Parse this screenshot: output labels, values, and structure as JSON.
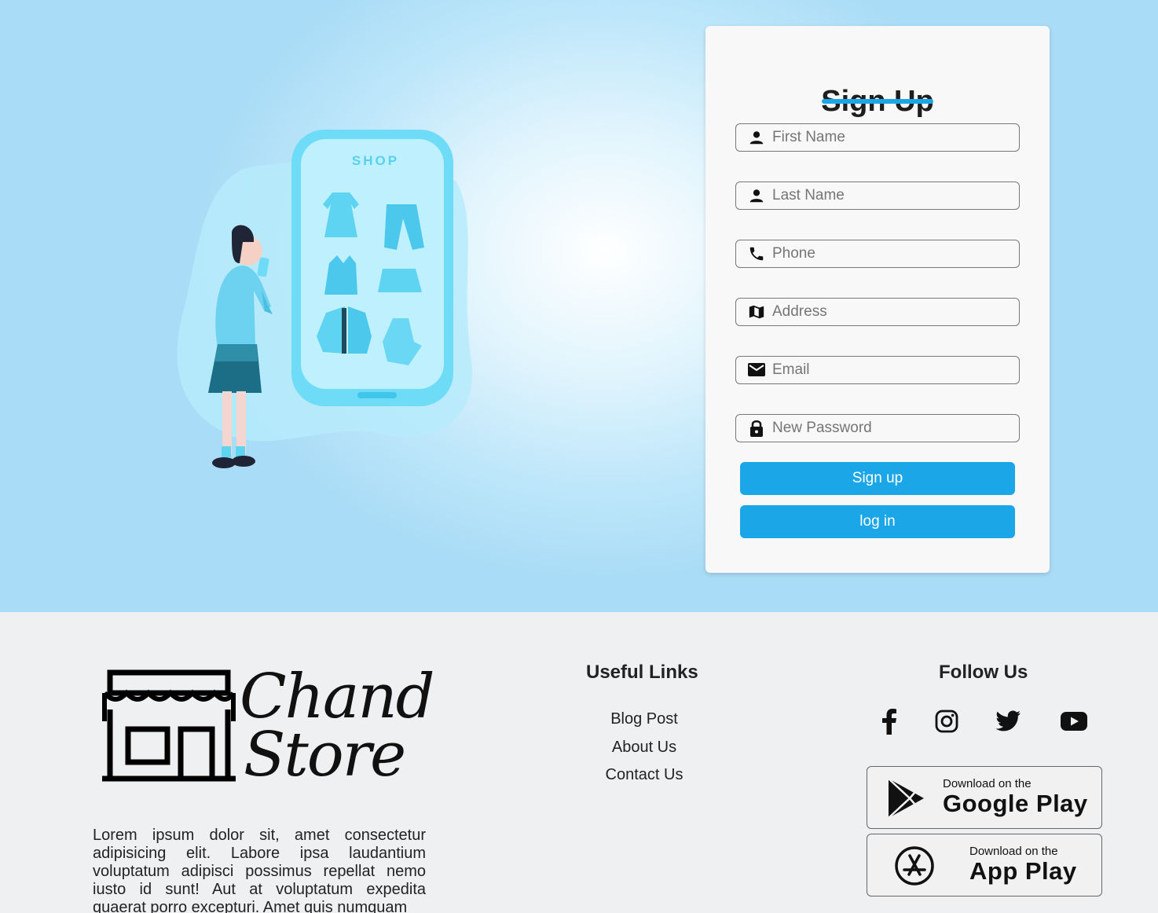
{
  "signup": {
    "title": "Sign Up",
    "fields": [
      {
        "icon": "person-icon",
        "placeholder": "First Name"
      },
      {
        "icon": "person-icon",
        "placeholder": "Last Name"
      },
      {
        "icon": "phone-icon",
        "placeholder": "Phone"
      },
      {
        "icon": "map-icon",
        "placeholder": "Address"
      },
      {
        "icon": "mail-icon",
        "placeholder": "Email"
      },
      {
        "icon": "lock-icon",
        "placeholder": "New Password"
      }
    ],
    "signup_button": "Sign up",
    "login_button": "log in"
  },
  "illustration": {
    "shop_label": "SHOP"
  },
  "footer": {
    "logo": {
      "line1": "Chand",
      "line2": "Store"
    },
    "about_text": "Lorem ipsum dolor sit, amet consectetur adipisicing elit. Labore ipsa laudantium voluptatum adipisci possimus repellat nemo iusto id sunt! Aut at voluptatum expedita quaerat porro excepturi. Amet quis numquam",
    "useful_links": {
      "title": "Useful Links",
      "items": [
        "Blog Post",
        "About Us",
        "Contact Us"
      ]
    },
    "follow": {
      "title": "Follow Us",
      "icons": [
        "facebook-icon",
        "instagram-icon",
        "twitter-icon",
        "youtube-icon"
      ]
    },
    "stores": [
      {
        "small": "Download on the",
        "big": "Google Play",
        "icon": "google-play-icon"
      },
      {
        "small": "Download on the",
        "big": "App Play",
        "icon": "app-store-icon"
      }
    ]
  },
  "colors": {
    "accent": "#1ba6e8",
    "hero_light": "#ffffff",
    "hero_dark": "#a9dcf6",
    "footer_bg": "#eff0f1",
    "illustration_blue": "#6fdcf7"
  }
}
